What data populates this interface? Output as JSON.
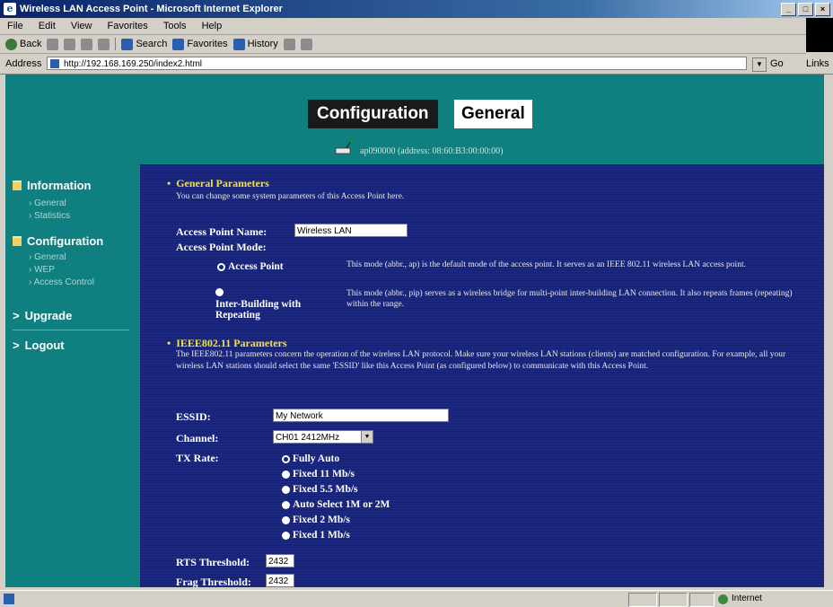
{
  "window": {
    "title": "Wireless LAN Access Point - Microsoft Internet Explorer",
    "controls": [
      "_",
      "□",
      "×"
    ]
  },
  "menu": [
    "File",
    "Edit",
    "View",
    "Favorites",
    "Tools",
    "Help"
  ],
  "toolbar": {
    "back": "Back",
    "search": "Search",
    "favorites": "Favorites",
    "history": "History"
  },
  "address": {
    "label": "Address",
    "url": "http://192.168.169.250/index2.html",
    "go": "Go",
    "links": "Links"
  },
  "header": {
    "config_tab": "Configuration",
    "general_tab": "General",
    "ap_info": "ap090000 (address: 08:60:B3:00:00:00)"
  },
  "sidebar": {
    "information": "Information",
    "info_items": [
      "General",
      "Statistics"
    ],
    "configuration": "Configuration",
    "config_items": [
      "General",
      "WEP",
      "Access Control"
    ],
    "upgrade": "Upgrade",
    "logout": "Logout",
    "upgrade_prefix": ">",
    "logout_prefix": ">"
  },
  "general_params": {
    "title": "General Parameters",
    "desc": "You can change some system parameters of this Access Point here.",
    "ap_name_label": "Access Point Name:",
    "ap_name_value": "Wireless LAN",
    "ap_mode_label": "Access Point Mode:",
    "mode_ap_label": "Access Point",
    "mode_ap_desc": "This mode (abbr., ap) is the default mode of the access point. It serves as an IEEE 802.11 wireless LAN access point.",
    "mode_bridge_label": "Inter-Building with Repeating",
    "mode_bridge_desc": "This mode (abbr., pip) serves as a wireless bridge for multi-point inter-building LAN connection. It also repeats frames (repeating) within the range."
  },
  "ieee_params": {
    "title": "IEEE802.11 Parameters",
    "desc": "The IEEE802.11 parameters concern the operation of the wireless LAN protocol. Make sure your wireless LAN stations (clients) are matched configuration. For example, all your wireless LAN stations should select the same 'ESSID' like this Access Point (as configured below) to communicate with this Access Point.",
    "essid_label": "ESSID:",
    "essid_value": "My Network",
    "channel_label": "Channel:",
    "channel_value": "CH01 2412MHz",
    "tx_label": "TX Rate:",
    "tx_options": [
      "Fully Auto",
      "Fixed 11 Mb/s",
      "Fixed 5.5 Mb/s",
      "Auto Select 1M or 2M",
      "Fixed 2 Mb/s",
      "Fixed 1 Mb/s"
    ],
    "tx_selected": 0,
    "rts_label": "RTS Threshold:",
    "rts_value": "2432",
    "frag_label": "Frag Threshold:",
    "frag_value": "2432"
  },
  "status": {
    "zone": "Internet"
  },
  "colors": {
    "page_bg": "#0f7f7f",
    "content_bg": "#17237a",
    "title_yellow": "#f2e24a"
  }
}
